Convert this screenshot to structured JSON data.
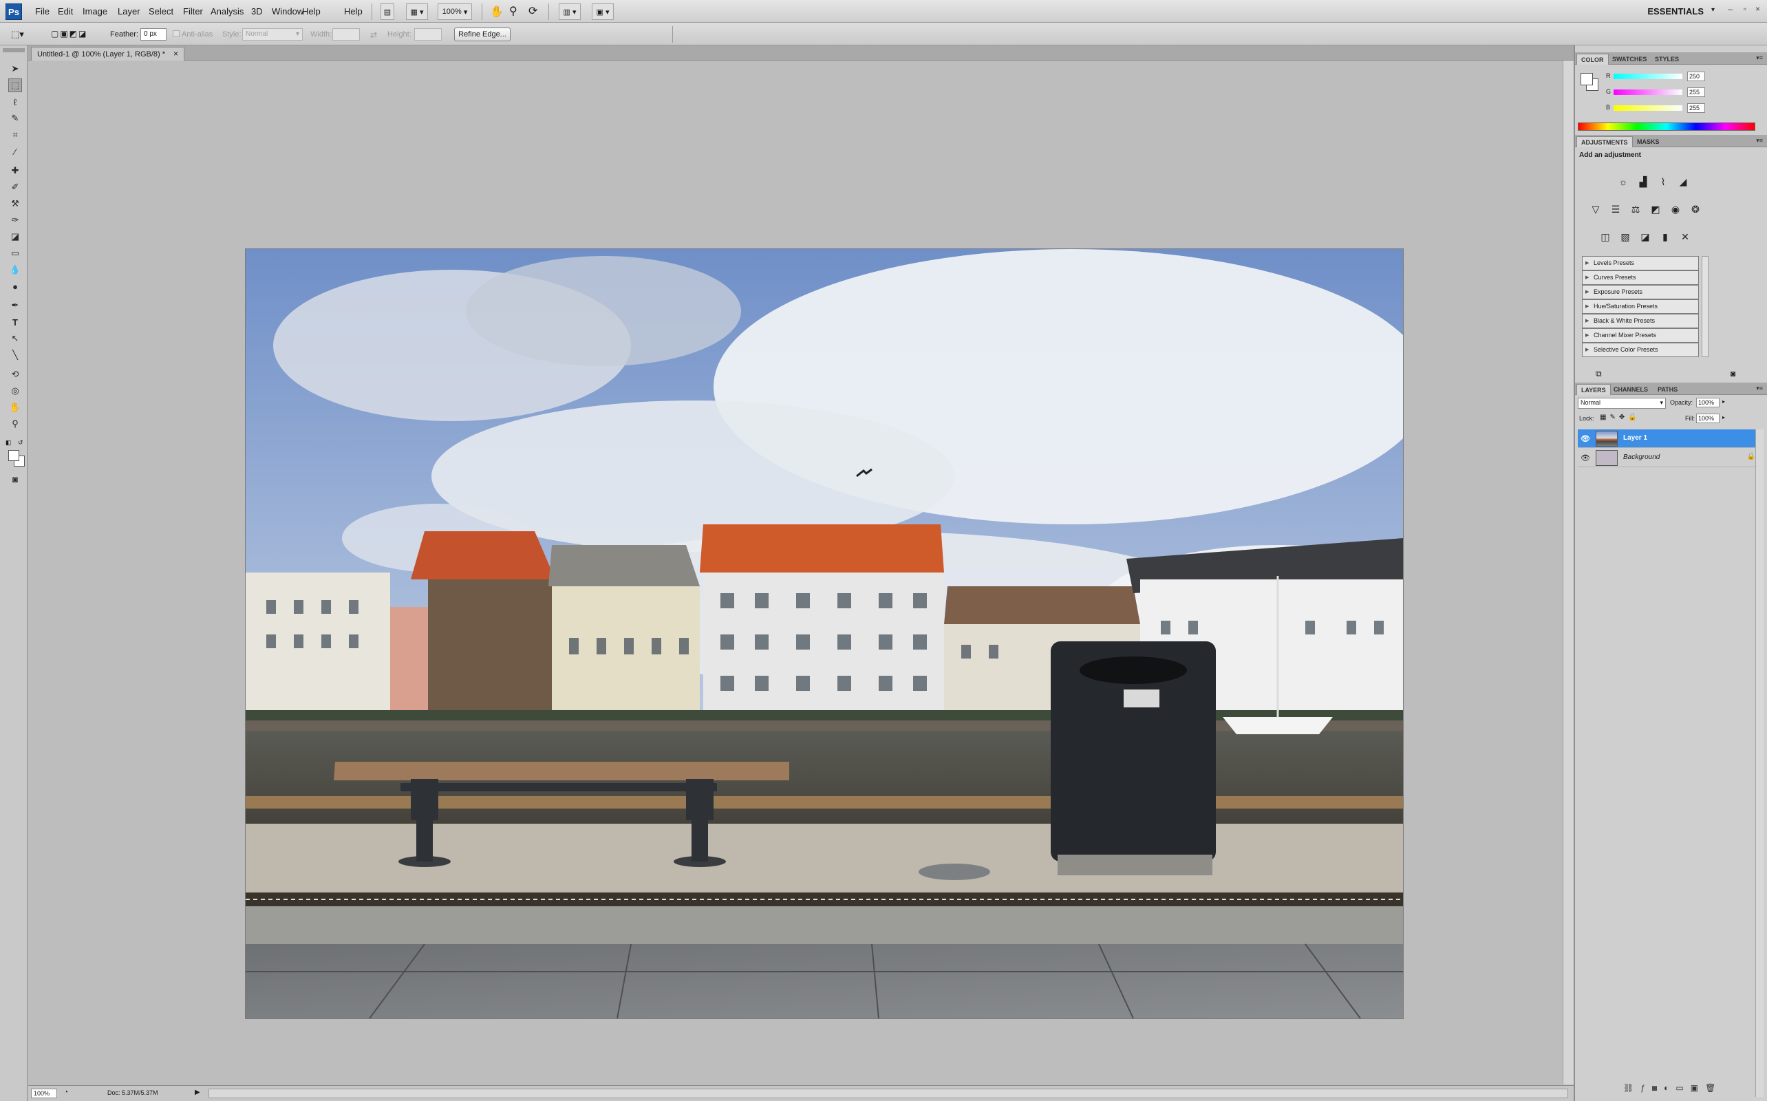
{
  "app": {
    "logo": "Ps",
    "menu": [
      "File",
      "Edit",
      "Image",
      "Layer",
      "Select",
      "Filter",
      "Analysis",
      "3D",
      "Window",
      "Help"
    ],
    "zoom": "100%",
    "workspace": "ESSENTIALS",
    "window_controls": [
      "–",
      "▫",
      "×"
    ]
  },
  "options": {
    "feather_label": "Feather:",
    "feather_value": "0 px",
    "antialias_label": "Anti-alias",
    "style_label": "Style:",
    "style_value": "Normal",
    "width_label": "Width:",
    "height_label": "Height:",
    "refine_edge": "Refine Edge..."
  },
  "document": {
    "tab_title": "Untitled-1 @ 100% (Layer 1, RGB/8) *",
    "tab_close": "×"
  },
  "status": {
    "zoom": "100%",
    "doc_size": "Doc: 5.37M/5.37M"
  },
  "color_panel": {
    "tabs": [
      "COLOR",
      "SWATCHES",
      "STYLES"
    ],
    "channels": [
      {
        "label": "R",
        "value": "250"
      },
      {
        "label": "G",
        "value": "255"
      },
      {
        "label": "B",
        "value": "255"
      }
    ]
  },
  "adjustments_panel": {
    "tabs": [
      "ADJUSTMENTS",
      "MASKS"
    ],
    "heading": "Add an adjustment",
    "icons_row1": [
      "brightness-icon",
      "levels-icon",
      "curves-icon",
      "exposure-icon"
    ],
    "icons_row2": [
      "vibrance-icon",
      "hue-saturation-icon",
      "color-balance-icon",
      "black-white-icon",
      "photo-filter-icon",
      "channel-mixer-icon"
    ],
    "icons_row3": [
      "invert-icon",
      "posterize-icon",
      "threshold-icon",
      "gradient-map-icon",
      "selective-color-icon"
    ],
    "presets": [
      "Levels Presets",
      "Curves Presets",
      "Exposure Presets",
      "Hue/Saturation Presets",
      "Black & White Presets",
      "Channel Mixer Presets",
      "Selective Color Presets"
    ]
  },
  "layers_panel": {
    "tabs": [
      "LAYERS",
      "CHANNELS",
      "PATHS"
    ],
    "blend_mode": "Normal",
    "opacity_label": "Opacity:",
    "opacity_value": "100%",
    "lock_label": "Lock:",
    "fill_label": "Fill:",
    "fill_value": "100%",
    "layers": [
      {
        "name": "Layer 1",
        "selected": true
      },
      {
        "name": "Background",
        "selected": false
      }
    ]
  }
}
